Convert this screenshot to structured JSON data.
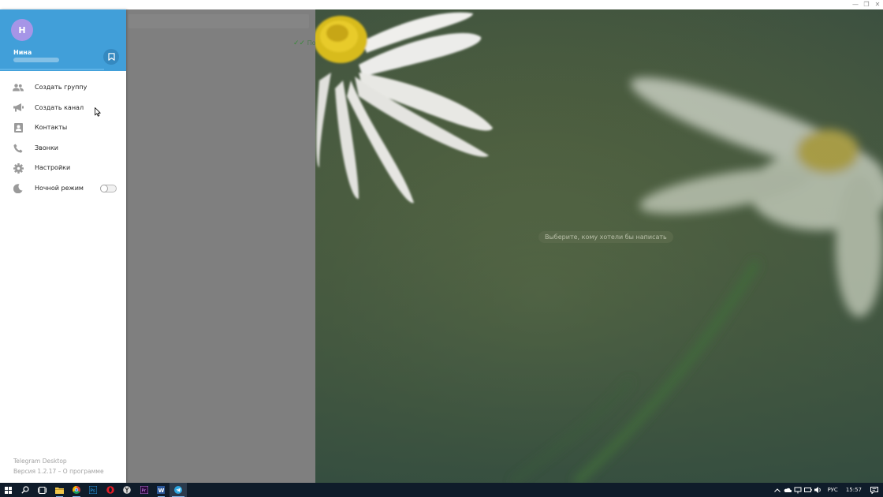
{
  "window": {
    "controls": [
      "—",
      "❐",
      "✕"
    ]
  },
  "chatlist": {
    "status_text": "По"
  },
  "chat": {
    "empty_prompt": "Выберите, кому хотели бы написать"
  },
  "menu": {
    "avatar_letter": "Н",
    "user_name": "Нина",
    "items": [
      {
        "label": "Создать группу",
        "icon": "group-icon"
      },
      {
        "label": "Создать канал",
        "icon": "megaphone-icon"
      },
      {
        "label": "Контакты",
        "icon": "contacts-icon"
      },
      {
        "label": "Звонки",
        "icon": "phone-icon"
      },
      {
        "label": "Настройки",
        "icon": "gear-icon"
      },
      {
        "label": "Ночной режим",
        "icon": "moon-icon",
        "toggle": false
      }
    ],
    "footer_app": "Telegram Desktop",
    "footer_version": "Версия 1.2.17 – О программе"
  },
  "taskbar": {
    "language": "РУС",
    "time": "15:57"
  },
  "colors": {
    "header_blue": "#419fd9",
    "avatar_purple": "#a695e7",
    "taskbar": "#0f1c2a"
  }
}
